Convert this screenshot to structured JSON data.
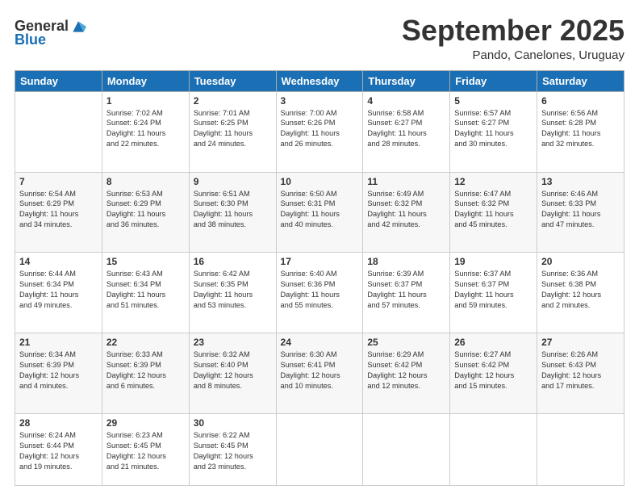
{
  "header": {
    "logo": {
      "general": "General",
      "blue": "Blue"
    },
    "title": "September 2025",
    "subtitle": "Pando, Canelones, Uruguay"
  },
  "days_of_week": [
    "Sunday",
    "Monday",
    "Tuesday",
    "Wednesday",
    "Thursday",
    "Friday",
    "Saturday"
  ],
  "weeks": [
    [
      {
        "day": "",
        "info": ""
      },
      {
        "day": "1",
        "info": "Sunrise: 7:02 AM\nSunset: 6:24 PM\nDaylight: 11 hours\nand 22 minutes."
      },
      {
        "day": "2",
        "info": "Sunrise: 7:01 AM\nSunset: 6:25 PM\nDaylight: 11 hours\nand 24 minutes."
      },
      {
        "day": "3",
        "info": "Sunrise: 7:00 AM\nSunset: 6:26 PM\nDaylight: 11 hours\nand 26 minutes."
      },
      {
        "day": "4",
        "info": "Sunrise: 6:58 AM\nSunset: 6:27 PM\nDaylight: 11 hours\nand 28 minutes."
      },
      {
        "day": "5",
        "info": "Sunrise: 6:57 AM\nSunset: 6:27 PM\nDaylight: 11 hours\nand 30 minutes."
      },
      {
        "day": "6",
        "info": "Sunrise: 6:56 AM\nSunset: 6:28 PM\nDaylight: 11 hours\nand 32 minutes."
      }
    ],
    [
      {
        "day": "7",
        "info": "Sunrise: 6:54 AM\nSunset: 6:29 PM\nDaylight: 11 hours\nand 34 minutes."
      },
      {
        "day": "8",
        "info": "Sunrise: 6:53 AM\nSunset: 6:29 PM\nDaylight: 11 hours\nand 36 minutes."
      },
      {
        "day": "9",
        "info": "Sunrise: 6:51 AM\nSunset: 6:30 PM\nDaylight: 11 hours\nand 38 minutes."
      },
      {
        "day": "10",
        "info": "Sunrise: 6:50 AM\nSunset: 6:31 PM\nDaylight: 11 hours\nand 40 minutes."
      },
      {
        "day": "11",
        "info": "Sunrise: 6:49 AM\nSunset: 6:32 PM\nDaylight: 11 hours\nand 42 minutes."
      },
      {
        "day": "12",
        "info": "Sunrise: 6:47 AM\nSunset: 6:32 PM\nDaylight: 11 hours\nand 45 minutes."
      },
      {
        "day": "13",
        "info": "Sunrise: 6:46 AM\nSunset: 6:33 PM\nDaylight: 11 hours\nand 47 minutes."
      }
    ],
    [
      {
        "day": "14",
        "info": "Sunrise: 6:44 AM\nSunset: 6:34 PM\nDaylight: 11 hours\nand 49 minutes."
      },
      {
        "day": "15",
        "info": "Sunrise: 6:43 AM\nSunset: 6:34 PM\nDaylight: 11 hours\nand 51 minutes."
      },
      {
        "day": "16",
        "info": "Sunrise: 6:42 AM\nSunset: 6:35 PM\nDaylight: 11 hours\nand 53 minutes."
      },
      {
        "day": "17",
        "info": "Sunrise: 6:40 AM\nSunset: 6:36 PM\nDaylight: 11 hours\nand 55 minutes."
      },
      {
        "day": "18",
        "info": "Sunrise: 6:39 AM\nSunset: 6:37 PM\nDaylight: 11 hours\nand 57 minutes."
      },
      {
        "day": "19",
        "info": "Sunrise: 6:37 AM\nSunset: 6:37 PM\nDaylight: 11 hours\nand 59 minutes."
      },
      {
        "day": "20",
        "info": "Sunrise: 6:36 AM\nSunset: 6:38 PM\nDaylight: 12 hours\nand 2 minutes."
      }
    ],
    [
      {
        "day": "21",
        "info": "Sunrise: 6:34 AM\nSunset: 6:39 PM\nDaylight: 12 hours\nand 4 minutes."
      },
      {
        "day": "22",
        "info": "Sunrise: 6:33 AM\nSunset: 6:39 PM\nDaylight: 12 hours\nand 6 minutes."
      },
      {
        "day": "23",
        "info": "Sunrise: 6:32 AM\nSunset: 6:40 PM\nDaylight: 12 hours\nand 8 minutes."
      },
      {
        "day": "24",
        "info": "Sunrise: 6:30 AM\nSunset: 6:41 PM\nDaylight: 12 hours\nand 10 minutes."
      },
      {
        "day": "25",
        "info": "Sunrise: 6:29 AM\nSunset: 6:42 PM\nDaylight: 12 hours\nand 12 minutes."
      },
      {
        "day": "26",
        "info": "Sunrise: 6:27 AM\nSunset: 6:42 PM\nDaylight: 12 hours\nand 15 minutes."
      },
      {
        "day": "27",
        "info": "Sunrise: 6:26 AM\nSunset: 6:43 PM\nDaylight: 12 hours\nand 17 minutes."
      }
    ],
    [
      {
        "day": "28",
        "info": "Sunrise: 6:24 AM\nSunset: 6:44 PM\nDaylight: 12 hours\nand 19 minutes."
      },
      {
        "day": "29",
        "info": "Sunrise: 6:23 AM\nSunset: 6:45 PM\nDaylight: 12 hours\nand 21 minutes."
      },
      {
        "day": "30",
        "info": "Sunrise: 6:22 AM\nSunset: 6:45 PM\nDaylight: 12 hours\nand 23 minutes."
      },
      {
        "day": "",
        "info": ""
      },
      {
        "day": "",
        "info": ""
      },
      {
        "day": "",
        "info": ""
      },
      {
        "day": "",
        "info": ""
      }
    ]
  ]
}
